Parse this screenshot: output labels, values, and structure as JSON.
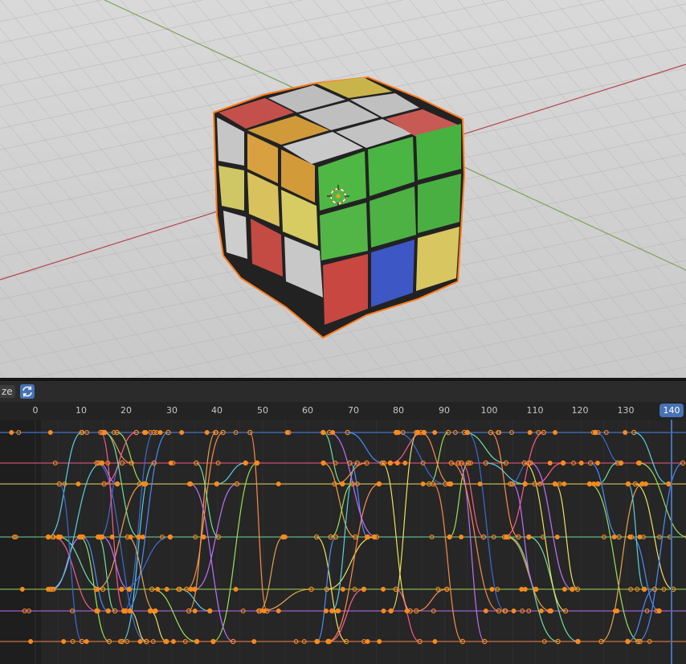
{
  "graph_editor": {
    "header": {
      "mode_label": "ze",
      "normalize_icon": "normalize-icon"
    },
    "ruler": {
      "ticks": [
        "0",
        "10",
        "20",
        "30",
        "40",
        "50",
        "60",
        "70",
        "80",
        "90",
        "100",
        "110",
        "120",
        "130"
      ],
      "current_frame": "140"
    }
  },
  "colors": {
    "accent": "#4772b3",
    "selection_outline": "#ff7a1a",
    "keyframe": "#ff8a1a",
    "x_axis": "#a8444a",
    "y_axis": "#6f9a4a"
  }
}
